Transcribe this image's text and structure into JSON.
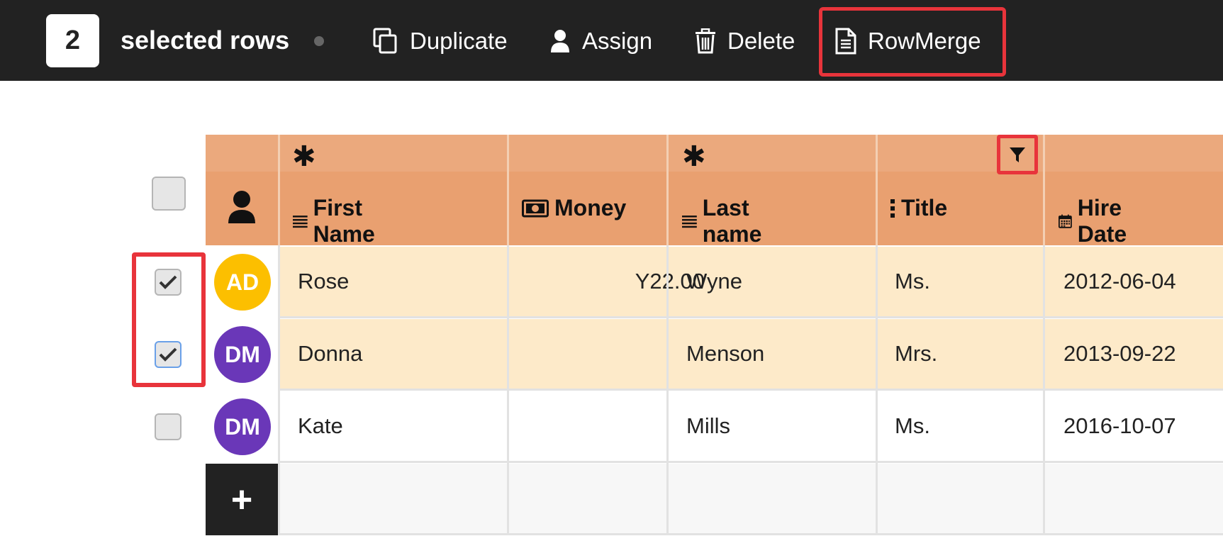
{
  "toolbar": {
    "selected_count": "2",
    "selected_label": "selected rows",
    "buttons": {
      "duplicate": "Duplicate",
      "assign": "Assign",
      "delete": "Delete",
      "rowmerge": "RowMerge"
    }
  },
  "grid": {
    "required_marker": "✱",
    "add_row_label": "+",
    "columns": {
      "first_name": "First Name",
      "money": "Money",
      "last_name": "Last name",
      "title": "Title",
      "hire_date": "Hire Date"
    },
    "rows": [
      {
        "initials": "AD",
        "avatar_color": "#fcbf00",
        "first": "Rose",
        "money": "Y22.00",
        "last": "Wyne",
        "title": "Ms.",
        "hire": "2012-06-04",
        "checked": true
      },
      {
        "initials": "DM",
        "avatar_color": "#6a37b8",
        "first": "Donna",
        "money": "",
        "last": "Menson",
        "title": "Mrs.",
        "hire": "2013-09-22",
        "checked": true
      },
      {
        "initials": "DM",
        "avatar_color": "#6a37b8",
        "first": "Kate",
        "money": "",
        "last": "Mills",
        "title": "Ms.",
        "hire": "2016-10-07",
        "checked": false
      }
    ]
  },
  "colors": {
    "toolbar_bg": "#222222",
    "header_bg": "#e9a070",
    "selected_row_bg": "#fdeac9",
    "highlight": "#e8343b"
  }
}
